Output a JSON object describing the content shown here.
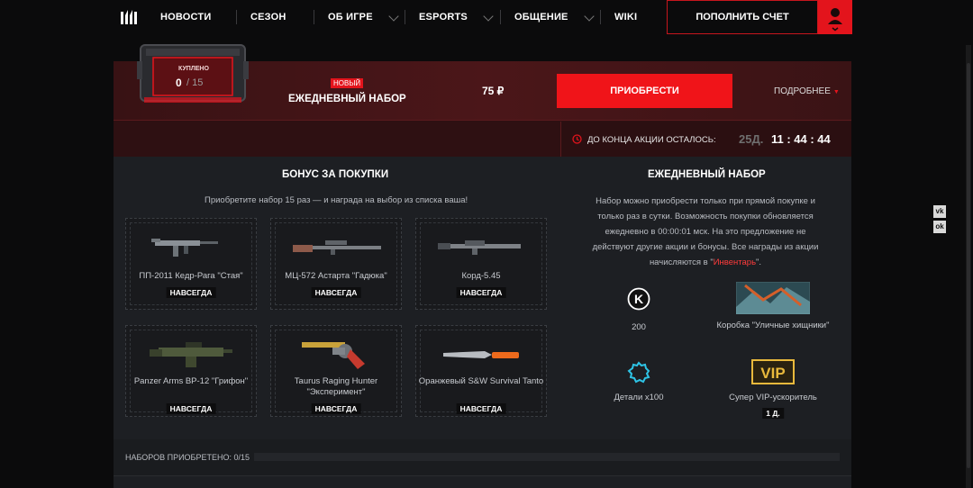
{
  "nav": {
    "items": [
      {
        "label": "НОВОСТИ"
      },
      {
        "label": "СЕЗОН"
      },
      {
        "label": "ОБ ИГРЕ"
      },
      {
        "label": "ESPORTS"
      },
      {
        "label": "ОБЩЕНИЕ"
      },
      {
        "label": "WIKI"
      }
    ],
    "topup_label": "ПОПОЛНИТЬ СЧЕТ"
  },
  "social": [
    "vk",
    "ok"
  ],
  "offer": {
    "chest_caption": "КУПЛЕНО",
    "chest_count": "0",
    "chest_total": "/ 15",
    "new_badge": "НОВЫЙ",
    "title": "ЕЖЕДНЕВНЫЙ НАБОР",
    "price": "75 ₽",
    "buy_label": "ПРИОБРЕСТИ",
    "more_label": "ПОДРОБНЕЕ",
    "timer_label": "ДО КОНЦА АКЦИИ ОСТАЛОСЬ:",
    "timer_days": "25Д.",
    "timer_time": "11 : 44 : 44"
  },
  "bonus": {
    "title": "БОНУС ЗА ПОКУПКИ",
    "subtitle": "Приобретите набор 15 раз — и награда на выбор из списка ваша!",
    "items": [
      {
        "name": "ПП-2011 Кедр-Рага \"Стая\"",
        "tag": "НАВСЕГДА"
      },
      {
        "name": "МЦ-572 Астарта \"Гадюка\"",
        "tag": "НАВСЕГДА"
      },
      {
        "name": "Корд-5.45",
        "tag": "НАВСЕГДА"
      },
      {
        "name": "Panzer Arms BP-12 \"Грифон\"",
        "tag": "НАВСЕГДА"
      },
      {
        "name": "Taurus Raging Hunter \"Эксперимент\"",
        "tag": "НАВСЕГДА"
      },
      {
        "name": "Оранжевый S&W Survival Tanto",
        "tag": "НАВСЕГДА"
      }
    ]
  },
  "daily": {
    "title": "ЕЖЕДНЕВНЫЙ НАБОР",
    "desc_lines": [
      "Набор можно приобрести только при прямой покупке и",
      "только раз в сутки. Возможность покупки обновляется",
      "ежедневно в 00:00:01 мск. На это предложение не",
      "действуют другие акции и бонусы. Все награды из акции"
    ],
    "desc_last_prefix": "начисляются в \"",
    "desc_last_link": "Инвентарь",
    "desc_last_suffix": "\".",
    "rewards": [
      {
        "icon": "k-coin-icon",
        "label": "200"
      },
      {
        "icon": "street-predators-box-icon",
        "label": "Коробка \"Уличные хищники\""
      },
      {
        "icon": "parts-gear-icon",
        "label": "Детали x100"
      },
      {
        "icon": "vip-booster-icon",
        "label": "Супер VIP-ускоритель",
        "tag": "1 Д."
      }
    ],
    "vip_text": "VIP",
    "k_text": "K"
  },
  "footer": {
    "progress_label": "НАБОРОВ ПРИОБРЕТЕНО: 0/15",
    "progress": 0
  },
  "colors": {
    "accent": "#e3141c",
    "link": "#ff3b3b",
    "panel": "#1d1f23",
    "vip_gold": "#e9b93c",
    "parts_cyan": "#2ec4e6"
  }
}
